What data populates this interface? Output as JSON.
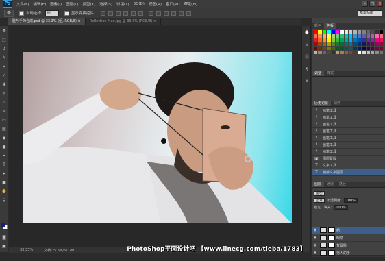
{
  "app": {
    "logo": "Ps"
  },
  "menubar": {
    "items": [
      "文件(F)",
      "编辑(E)",
      "图像(I)",
      "图层(L)",
      "类型(Y)",
      "选择(S)",
      "滤镜(T)",
      "3D(D)",
      "视图(V)",
      "窗口(W)",
      "帮助(H)"
    ]
  },
  "window_controls": {
    "minimize": "–",
    "maximize": "□",
    "close": "×"
  },
  "options": {
    "auto_select_label": "自动选择:",
    "auto_select_value": "组",
    "show_transform_label": "显示变换控件",
    "workspace": "基本功能"
  },
  "tabs": [
    {
      "label": "脸与手的合成.psd @ 33.3% (组, RGB/8) ×"
    },
    {
      "label": "Reflection Man.jpg @ 33.3% (RGB/8) ×"
    }
  ],
  "status": {
    "zoom": "33.33%",
    "doc": "文档:25.6M/51.2M"
  },
  "panels": {
    "color_tabs": [
      "颜色",
      "色板"
    ],
    "adjust_tabs": [
      "调整",
      "样式"
    ],
    "history_tabs": [
      "历史记录",
      "动作"
    ],
    "history": [
      {
        "label": "画笔工具"
      },
      {
        "label": "画笔工具"
      },
      {
        "label": "画笔工具"
      },
      {
        "label": "画笔工具"
      },
      {
        "label": "画笔工具"
      },
      {
        "label": "画笔工具"
      },
      {
        "label": "画笔工具"
      },
      {
        "label": "图层蒙版"
      },
      {
        "label": "文字工具"
      },
      {
        "label": "横排文字图层"
      }
    ],
    "layers_tabs": [
      "图层",
      "通道",
      "路径"
    ],
    "kind_label": "类型",
    "blend_mode": "正常",
    "opacity_label": "不透明度:",
    "opacity": "100%",
    "lock_label": "锁定:",
    "fill_label": "填充:",
    "fill": "100%",
    "layers": [
      {
        "name": "组"
      },
      {
        "name": "眼睛"
      },
      {
        "name": "背景脸"
      },
      {
        "name": "男人的手"
      }
    ]
  },
  "swatch_colors": [
    "#ff0000",
    "#ffff00",
    "#00ff00",
    "#00ffff",
    "#0000ff",
    "#ff00ff",
    "#ffffff",
    "#e6e6e6",
    "#cccccc",
    "#b3b3b3",
    "#999999",
    "#808080",
    "#666666",
    "#4d4d4d",
    "#333333",
    "#000000",
    "#f26c4f",
    "#f68e55",
    "#fbaf5c",
    "#fff467",
    "#acd372",
    "#7cc576",
    "#3bb878",
    "#1abbb4",
    "#00bff3",
    "#438ccb",
    "#5574b9",
    "#605ca8",
    "#855fa8",
    "#a763a8",
    "#f06ea9",
    "#f26d7d",
    "#ed1c24",
    "#f26522",
    "#f7941d",
    "#fff200",
    "#8dc63f",
    "#39b54a",
    "#00a651",
    "#00a99d",
    "#00aeef",
    "#0072bc",
    "#0054a6",
    "#2e3192",
    "#662d91",
    "#92278f",
    "#ec008c",
    "#ed145b",
    "#9e0b0f",
    "#a0410d",
    "#a36209",
    "#aba000",
    "#598527",
    "#1a7b30",
    "#007236",
    "#00746b",
    "#0076a3",
    "#004b80",
    "#003471",
    "#1b1464",
    "#440e62",
    "#630460",
    "#9e005d",
    "#9e0039",
    "#790000",
    "#7b2e00",
    "#7d4900",
    "#827b00",
    "#406618",
    "#005e20",
    "#005826",
    "#005952",
    "#005b7f",
    "#003663",
    "#002157",
    "#0d004c",
    "#32004b",
    "#4b0049",
    "#7b0046",
    "#7a0026",
    "#c7b299",
    "#998675",
    "#736357",
    "#534741",
    "#37302d",
    "#c69c6d",
    "#a67c52",
    "#8c6239",
    "#754c24",
    "#603913",
    "#ffffff",
    "#d9d9d9",
    "#bfbfbf",
    "#a6a6a6",
    "#8c8c8c",
    "#737373"
  ],
  "watermark": "PhotoShop平面设计吧 【www.linecg.com/tieba/1783】"
}
